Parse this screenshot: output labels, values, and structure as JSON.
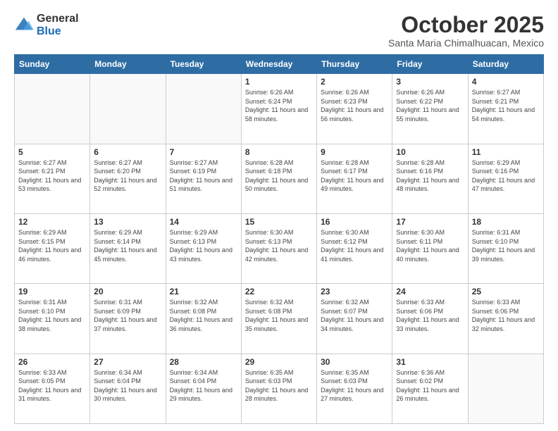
{
  "logo": {
    "general": "General",
    "blue": "Blue"
  },
  "title": "October 2025",
  "location": "Santa Maria Chimalhuacan, Mexico",
  "days_of_week": [
    "Sunday",
    "Monday",
    "Tuesday",
    "Wednesday",
    "Thursday",
    "Friday",
    "Saturday"
  ],
  "weeks": [
    [
      {
        "day": null,
        "info": null
      },
      {
        "day": null,
        "info": null
      },
      {
        "day": null,
        "info": null
      },
      {
        "day": "1",
        "info": "Sunrise: 6:26 AM\nSunset: 6:24 PM\nDaylight: 11 hours and 58 minutes."
      },
      {
        "day": "2",
        "info": "Sunrise: 6:26 AM\nSunset: 6:23 PM\nDaylight: 11 hours and 56 minutes."
      },
      {
        "day": "3",
        "info": "Sunrise: 6:26 AM\nSunset: 6:22 PM\nDaylight: 11 hours and 55 minutes."
      },
      {
        "day": "4",
        "info": "Sunrise: 6:27 AM\nSunset: 6:21 PM\nDaylight: 11 hours and 54 minutes."
      }
    ],
    [
      {
        "day": "5",
        "info": "Sunrise: 6:27 AM\nSunset: 6:21 PM\nDaylight: 11 hours and 53 minutes."
      },
      {
        "day": "6",
        "info": "Sunrise: 6:27 AM\nSunset: 6:20 PM\nDaylight: 11 hours and 52 minutes."
      },
      {
        "day": "7",
        "info": "Sunrise: 6:27 AM\nSunset: 6:19 PM\nDaylight: 11 hours and 51 minutes."
      },
      {
        "day": "8",
        "info": "Sunrise: 6:28 AM\nSunset: 6:18 PM\nDaylight: 11 hours and 50 minutes."
      },
      {
        "day": "9",
        "info": "Sunrise: 6:28 AM\nSunset: 6:17 PM\nDaylight: 11 hours and 49 minutes."
      },
      {
        "day": "10",
        "info": "Sunrise: 6:28 AM\nSunset: 6:16 PM\nDaylight: 11 hours and 48 minutes."
      },
      {
        "day": "11",
        "info": "Sunrise: 6:29 AM\nSunset: 6:16 PM\nDaylight: 11 hours and 47 minutes."
      }
    ],
    [
      {
        "day": "12",
        "info": "Sunrise: 6:29 AM\nSunset: 6:15 PM\nDaylight: 11 hours and 46 minutes."
      },
      {
        "day": "13",
        "info": "Sunrise: 6:29 AM\nSunset: 6:14 PM\nDaylight: 11 hours and 45 minutes."
      },
      {
        "day": "14",
        "info": "Sunrise: 6:29 AM\nSunset: 6:13 PM\nDaylight: 11 hours and 43 minutes."
      },
      {
        "day": "15",
        "info": "Sunrise: 6:30 AM\nSunset: 6:13 PM\nDaylight: 11 hours and 42 minutes."
      },
      {
        "day": "16",
        "info": "Sunrise: 6:30 AM\nSunset: 6:12 PM\nDaylight: 11 hours and 41 minutes."
      },
      {
        "day": "17",
        "info": "Sunrise: 6:30 AM\nSunset: 6:11 PM\nDaylight: 11 hours and 40 minutes."
      },
      {
        "day": "18",
        "info": "Sunrise: 6:31 AM\nSunset: 6:10 PM\nDaylight: 11 hours and 39 minutes."
      }
    ],
    [
      {
        "day": "19",
        "info": "Sunrise: 6:31 AM\nSunset: 6:10 PM\nDaylight: 11 hours and 38 minutes."
      },
      {
        "day": "20",
        "info": "Sunrise: 6:31 AM\nSunset: 6:09 PM\nDaylight: 11 hours and 37 minutes."
      },
      {
        "day": "21",
        "info": "Sunrise: 6:32 AM\nSunset: 6:08 PM\nDaylight: 11 hours and 36 minutes."
      },
      {
        "day": "22",
        "info": "Sunrise: 6:32 AM\nSunset: 6:08 PM\nDaylight: 11 hours and 35 minutes."
      },
      {
        "day": "23",
        "info": "Sunrise: 6:32 AM\nSunset: 6:07 PM\nDaylight: 11 hours and 34 minutes."
      },
      {
        "day": "24",
        "info": "Sunrise: 6:33 AM\nSunset: 6:06 PM\nDaylight: 11 hours and 33 minutes."
      },
      {
        "day": "25",
        "info": "Sunrise: 6:33 AM\nSunset: 6:06 PM\nDaylight: 11 hours and 32 minutes."
      }
    ],
    [
      {
        "day": "26",
        "info": "Sunrise: 6:33 AM\nSunset: 6:05 PM\nDaylight: 11 hours and 31 minutes."
      },
      {
        "day": "27",
        "info": "Sunrise: 6:34 AM\nSunset: 6:04 PM\nDaylight: 11 hours and 30 minutes."
      },
      {
        "day": "28",
        "info": "Sunrise: 6:34 AM\nSunset: 6:04 PM\nDaylight: 11 hours and 29 minutes."
      },
      {
        "day": "29",
        "info": "Sunrise: 6:35 AM\nSunset: 6:03 PM\nDaylight: 11 hours and 28 minutes."
      },
      {
        "day": "30",
        "info": "Sunrise: 6:35 AM\nSunset: 6:03 PM\nDaylight: 11 hours and 27 minutes."
      },
      {
        "day": "31",
        "info": "Sunrise: 6:36 AM\nSunset: 6:02 PM\nDaylight: 11 hours and 26 minutes."
      },
      {
        "day": null,
        "info": null
      }
    ]
  ]
}
